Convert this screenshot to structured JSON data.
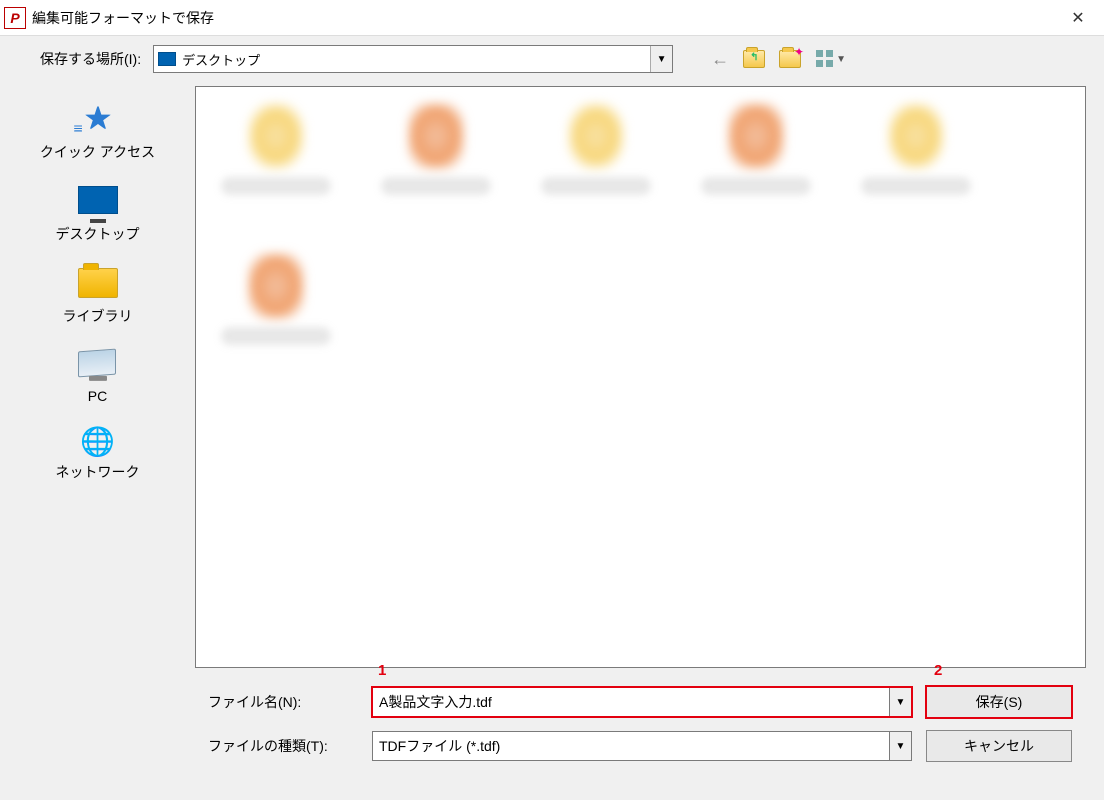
{
  "window": {
    "title": "編集可能フォーマットで保存"
  },
  "toolbar": {
    "location_label": "保存する場所(I):",
    "location_value": "デスクトップ"
  },
  "sidebar": {
    "items": [
      {
        "label": "クイック アクセス"
      },
      {
        "label": "デスクトップ"
      },
      {
        "label": "ライブラリ"
      },
      {
        "label": "PC"
      },
      {
        "label": "ネットワーク"
      }
    ]
  },
  "fields": {
    "filename_label": "ファイル名(N):",
    "filename_value": "A製品文字入力.tdf",
    "filetype_label": "ファイルの種類(T):",
    "filetype_value": "TDFファイル (*.tdf)"
  },
  "buttons": {
    "save": "保存(S)",
    "cancel": "キャンセル"
  },
  "annotations": {
    "one": "1",
    "two": "2"
  }
}
